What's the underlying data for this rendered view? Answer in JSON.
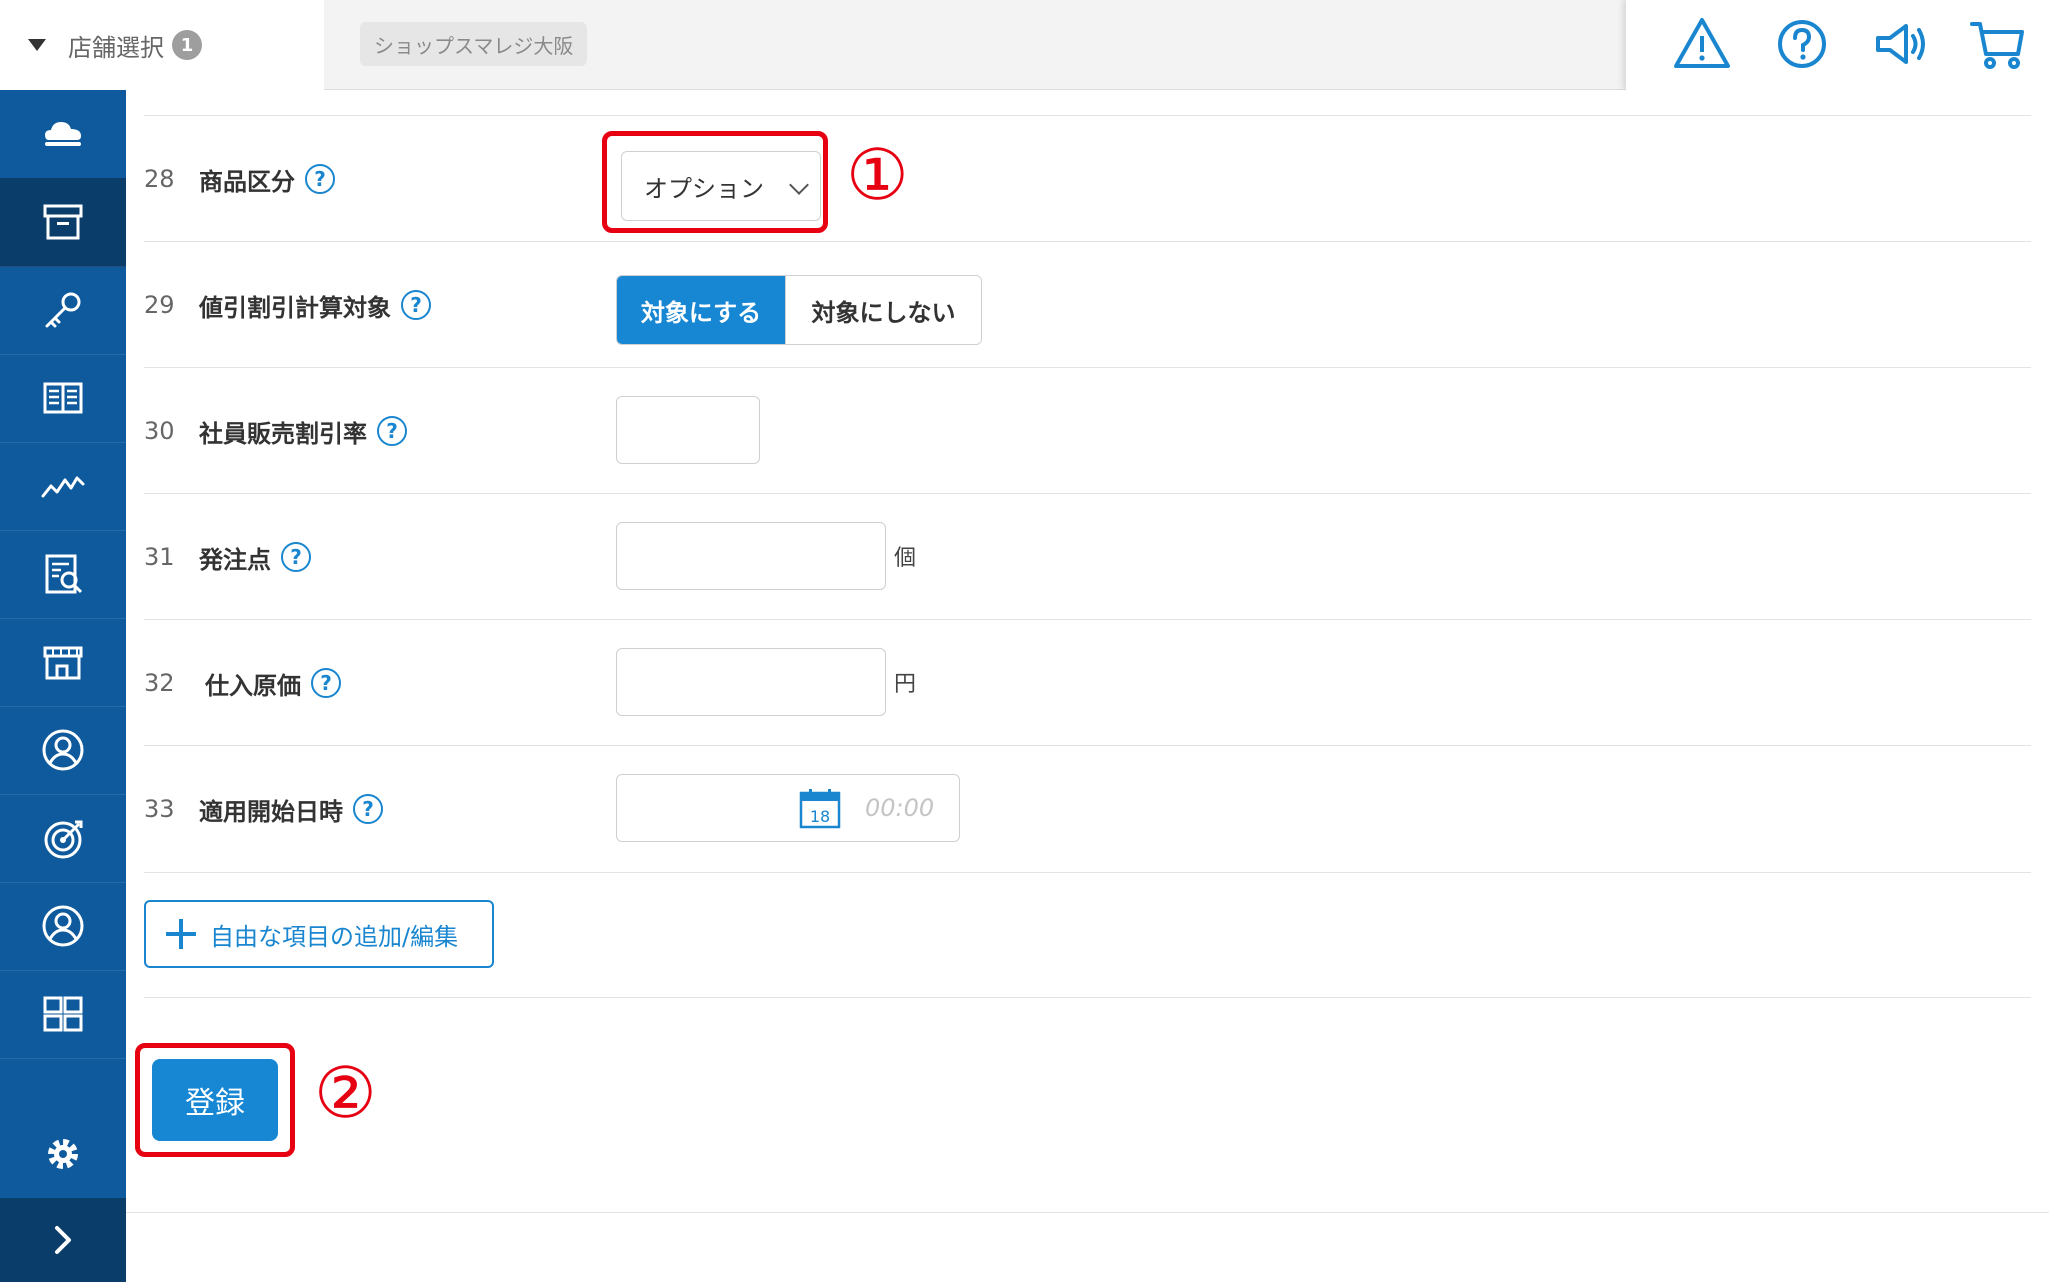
{
  "header": {
    "store_select_label": "店舗選択",
    "store_count": "1",
    "shop_name": "ショップスマレジ大阪",
    "icons": [
      "warning-icon",
      "help-circle-icon",
      "megaphone-icon",
      "cart-icon"
    ]
  },
  "sidebar": {
    "items": [
      "cloud-icon",
      "archive-box-icon",
      "key-icon",
      "book-icon",
      "chart-line-icon",
      "report-icon",
      "store-icon",
      "user-circle-icon",
      "target-icon",
      "user-circle-icon",
      "grid-icon"
    ],
    "settings_icon": "gear-icon",
    "expand_icon": "chevron-right-icon"
  },
  "form": {
    "rows": [
      {
        "num": "28",
        "label": "商品区分",
        "type": "select",
        "value": "オプション"
      },
      {
        "num": "29",
        "label": "値引割引計算対象",
        "type": "toggle",
        "option_on": "対象にする",
        "option_off": "対象にしない"
      },
      {
        "num": "30",
        "label": "社員販売割引率",
        "type": "input",
        "value": ""
      },
      {
        "num": "31",
        "label": "発注点",
        "type": "input",
        "value": "",
        "unit": "個"
      },
      {
        "num": "32",
        "label": "仕入原価",
        "type": "input",
        "value": "",
        "unit": "円"
      },
      {
        "num": "33",
        "label": "適用開始日時",
        "type": "datetime",
        "calendar_day": "18",
        "time_placeholder": "00:00"
      }
    ],
    "help_mark": "?",
    "add_button_label": "自由な項目の追加/編集",
    "register_button_label": "登録"
  },
  "annotations": {
    "marker_1": "①",
    "marker_2": "②"
  },
  "colors": {
    "sidebar": "#0f5a9c",
    "sidebar_active": "#0b3d6b",
    "primary": "#1787d4",
    "highlight_red": "#e60012"
  }
}
